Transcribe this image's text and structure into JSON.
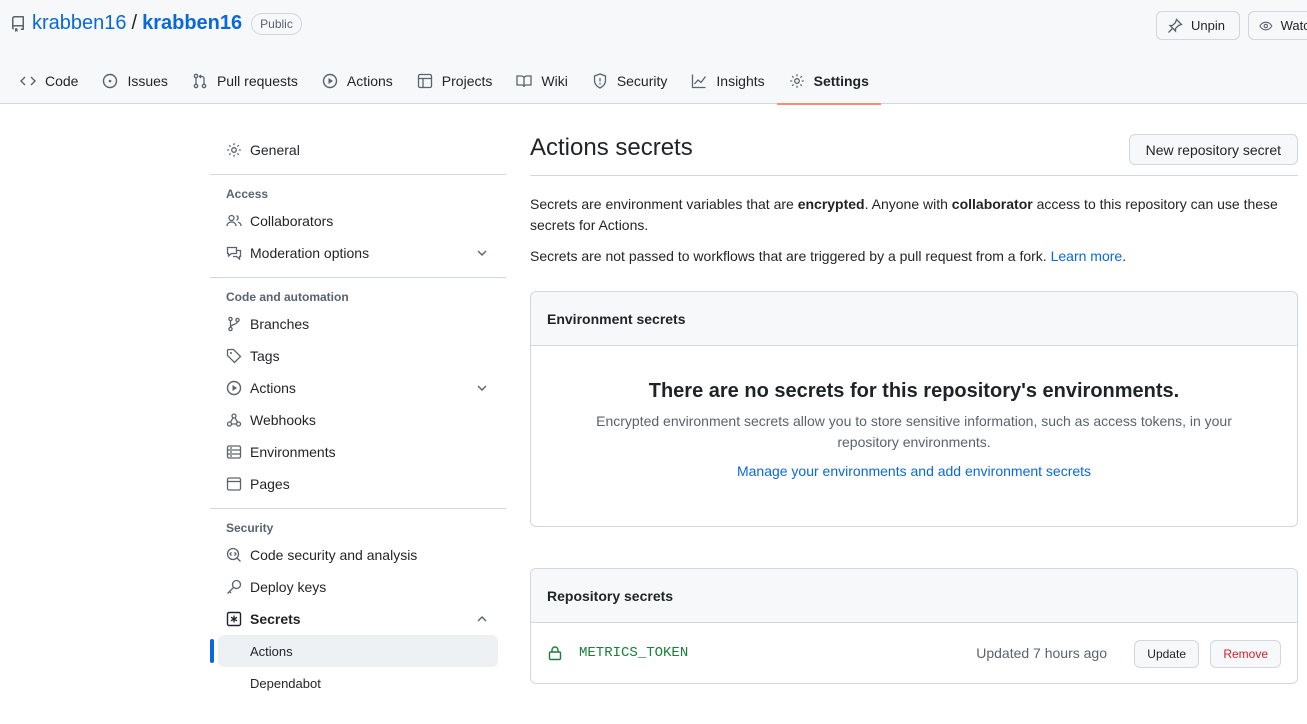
{
  "repo": {
    "owner": "krabben16",
    "separator": "/",
    "name": "krabben16",
    "visibility": "Public"
  },
  "header_buttons": {
    "unpin": "Unpin",
    "watch": "Watch"
  },
  "tabs": [
    {
      "label": "Code",
      "icon": "code-icon"
    },
    {
      "label": "Issues",
      "icon": "issue-icon"
    },
    {
      "label": "Pull requests",
      "icon": "pull-request-icon"
    },
    {
      "label": "Actions",
      "icon": "play-icon"
    },
    {
      "label": "Projects",
      "icon": "table-icon"
    },
    {
      "label": "Wiki",
      "icon": "book-icon"
    },
    {
      "label": "Security",
      "icon": "shield-icon"
    },
    {
      "label": "Insights",
      "icon": "graph-icon"
    },
    {
      "label": "Settings",
      "icon": "gear-icon",
      "active": true
    }
  ],
  "sidebar": {
    "general": "General",
    "access_heading": "Access",
    "collaborators": "Collaborators",
    "moderation": "Moderation options",
    "code_heading": "Code and automation",
    "branches": "Branches",
    "tags": "Tags",
    "actions": "Actions",
    "webhooks": "Webhooks",
    "environments": "Environments",
    "pages": "Pages",
    "security_heading": "Security",
    "code_security": "Code security and analysis",
    "deploy_keys": "Deploy keys",
    "secrets": "Secrets",
    "secrets_actions": "Actions",
    "secrets_dependabot": "Dependabot"
  },
  "main": {
    "title": "Actions secrets",
    "new_button": "New repository secret",
    "desc_p1_a": "Secrets are environment variables that are ",
    "desc_p1_b": "encrypted",
    "desc_p1_c": ". Anyone with ",
    "desc_p1_d": "collaborator",
    "desc_p1_e": " access to this repository can use these secrets for Actions.",
    "desc_p2": "Secrets are not passed to workflows that are triggered by a pull request from a fork. ",
    "learn_more": "Learn more",
    "period": "."
  },
  "env_box": {
    "header": "Environment secrets",
    "blank_title": "There are no secrets for this repository's environments.",
    "blank_text": "Encrypted environment secrets allow you to store sensitive information, such as access tokens, in your repository environments.",
    "blank_link": "Manage your environments and add environment secrets"
  },
  "repo_box": {
    "header": "Repository secrets",
    "secrets": [
      {
        "name": "METRICS_TOKEN",
        "updated": "Updated 7 hours ago",
        "update_label": "Update",
        "remove_label": "Remove"
      }
    ]
  }
}
